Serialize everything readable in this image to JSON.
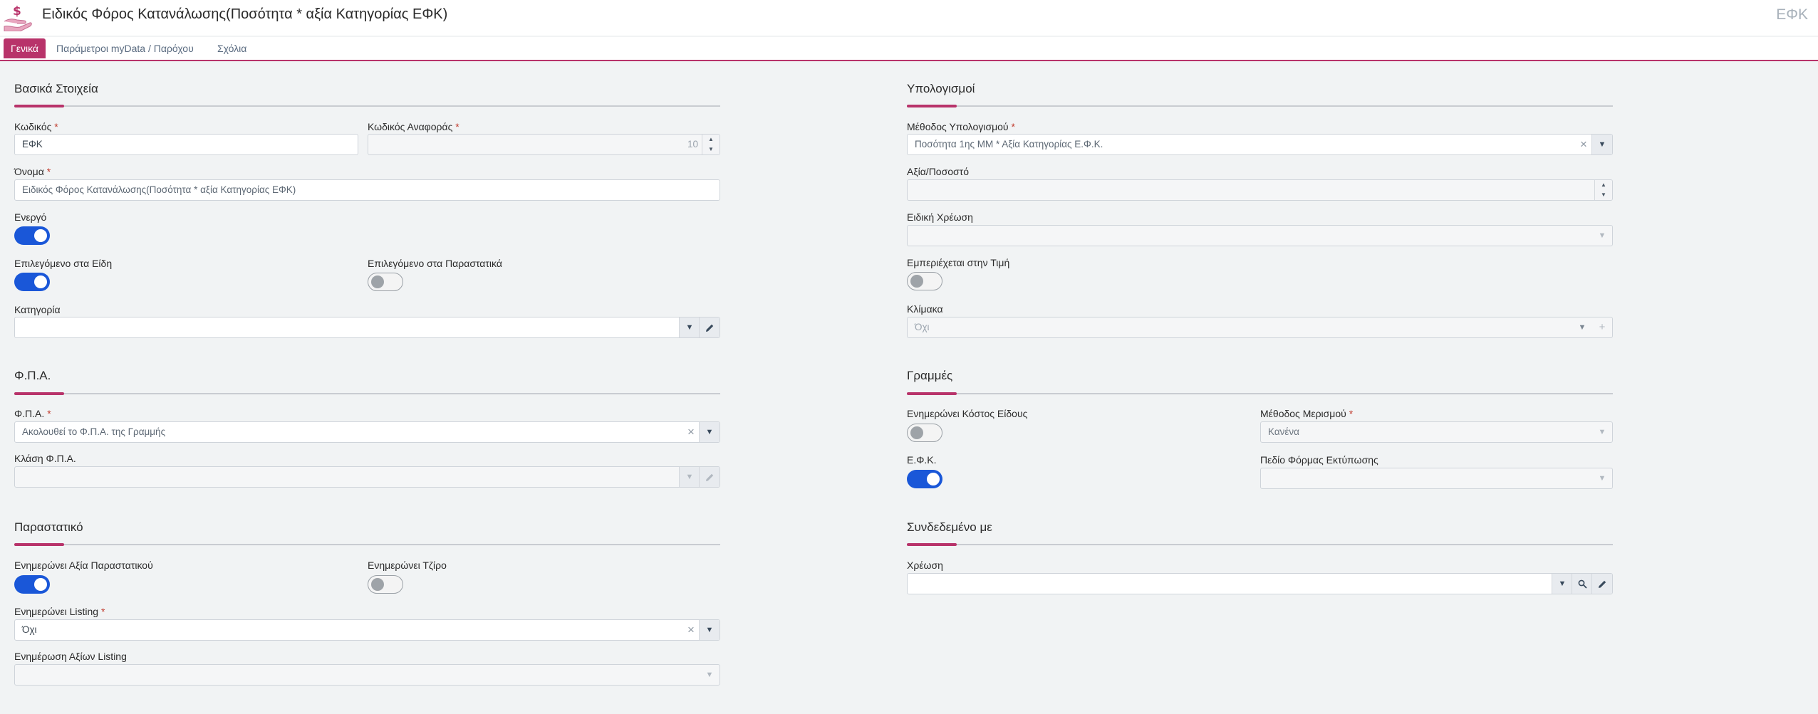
{
  "header": {
    "title": "Ειδικός Φόρος Κατανάλωσης(Ποσότητα * αξία Κατηγορίας ΕΦΚ)",
    "code": "ΕΦΚ"
  },
  "tabs": [
    {
      "label": "Γενικά",
      "active": true
    },
    {
      "label": "Παράμετροι myData / Παρόχου",
      "active": false
    },
    {
      "label": "Σχόλια",
      "active": false
    }
  ],
  "required_mark": "*",
  "basic": {
    "title": "Βασικά Στοιχεία",
    "code_label": "Κωδικός",
    "code_value": "ΕΦΚ",
    "ref_code_label": "Κωδικός Αναφοράς",
    "ref_code_value": "10",
    "name_label": "Όνομα",
    "name_value": "Ειδικός Φόρος Κατανάλωσης(Ποσότητα * αξία Κατηγορίας ΕΦΚ)",
    "active_label": "Ενεργό",
    "active_on": true,
    "default_items_label": "Επιλεγόμενο στα Είδη",
    "default_items_on": true,
    "default_docs_label": "Επιλεγόμενο στα Παραστατικά",
    "default_docs_on": false,
    "category_label": "Κατηγορία",
    "category_value": ""
  },
  "vat": {
    "title": "Φ.Π.Α.",
    "vat_label": "Φ.Π.Α.",
    "vat_value": "Ακολουθεί το Φ.Π.Α. της Γραμμής",
    "vat_class_label": "Κλάση Φ.Π.Α.",
    "vat_class_value": ""
  },
  "document": {
    "title": "Παραστατικό",
    "updates_doc_value_label": "Ενημερώνει Αξία Παραστατικού",
    "updates_doc_value_on": true,
    "updates_turnover_label": "Ενημερώνει Τζίρο",
    "updates_turnover_on": false,
    "updates_listing_label": "Ενημερώνει Listing",
    "updates_listing_value": "Όχι",
    "listing_values_label": "Ενημέρωση Αξίων Listing",
    "listing_values_value": ""
  },
  "calc": {
    "title": "Υπολογισμοί",
    "method_label": "Μέθοδος Υπολογισμού",
    "method_value": "Ποσότητα 1ης ΜΜ * Αξία Κατηγορίας Ε.Φ.Κ.",
    "value_pct_label": "Αξία/Ποσοστό",
    "value_pct_value": "",
    "special_charge_label": "Ειδική Χρέωση",
    "special_charge_value": "",
    "included_in_price_label": "Εμπεριέχεται στην Τιμή",
    "included_in_price_on": false,
    "scale_label": "Κλίμακα",
    "scale_value": "Όχι"
  },
  "lines": {
    "title": "Γραμμές",
    "updates_cost_label": "Ενημερώνει Κόστος Είδους",
    "updates_cost_on": false,
    "allocation_method_label": "Μέθοδος Μερισμού",
    "allocation_method_value": "Κανένα",
    "efk_label": "Ε.Φ.Κ.",
    "efk_on": true,
    "print_field_label": "Πεδίο Φόρμας Εκτύπωσης",
    "print_field_value": ""
  },
  "linked": {
    "title": "Συνδεδεμένο με",
    "charge_label": "Χρέωση",
    "charge_value": ""
  },
  "colors": {
    "accent": "#b8336a",
    "toggle_on": "#1a57d8",
    "background": "#f1f3f4"
  },
  "icons": {
    "app": "hand-money-icon",
    "dropdown": "caret-down-icon",
    "edit": "pencil-icon",
    "clear": "clear-x-icon",
    "search": "magnifier-icon",
    "add": "plus-icon"
  }
}
